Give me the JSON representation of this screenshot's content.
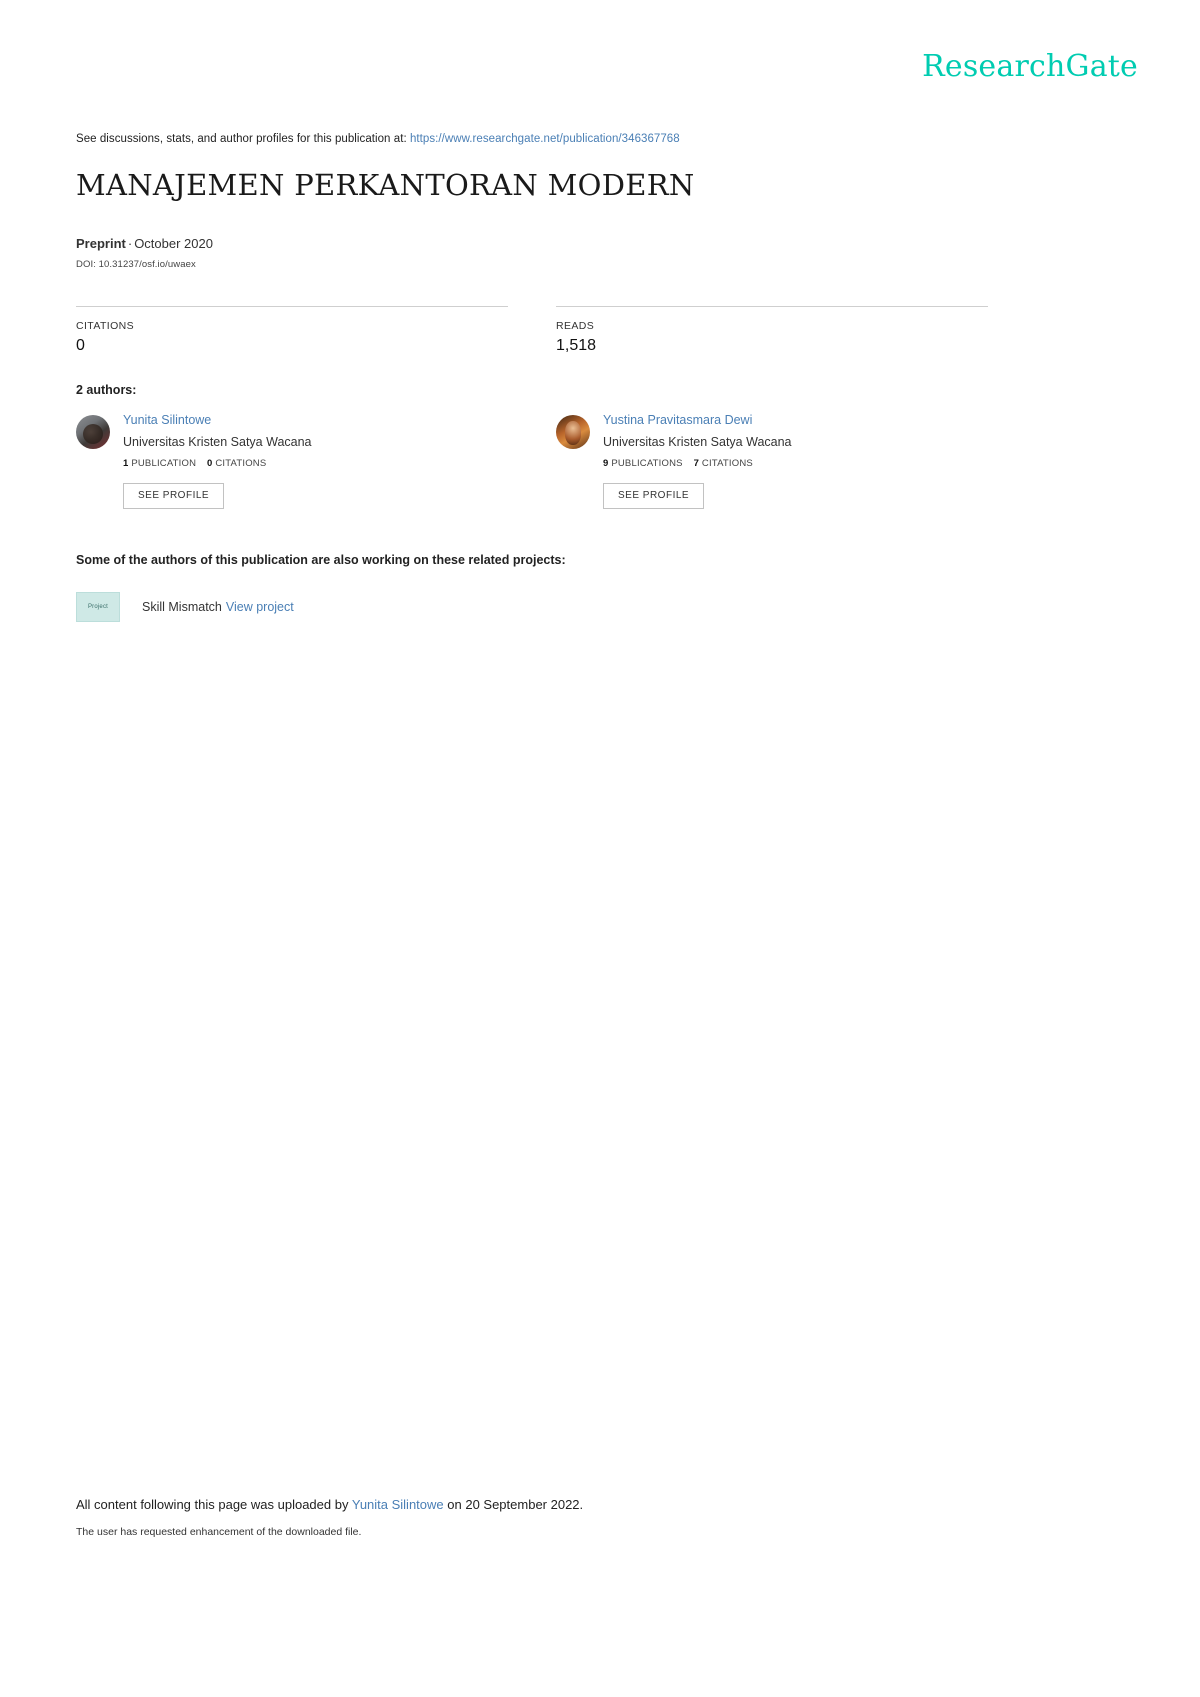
{
  "brand": {
    "logo_text": "ResearchGate",
    "logo_color": "#00ccb1",
    "link_color": "#4a7fb5"
  },
  "header": {
    "discussions_prefix": "See discussions, stats, and author profiles for this publication at:",
    "publication_url": "https://www.researchgate.net/publication/346367768"
  },
  "publication": {
    "title": "MANAJEMEN PERKANTORAN MODERN",
    "type": "Preprint",
    "separator": "·",
    "date": "October 2020",
    "doi": "DOI: 10.31237/osf.io/uwaex"
  },
  "stats": [
    {
      "label": "CITATIONS",
      "value": "0"
    },
    {
      "label": "READS",
      "value": "1,518"
    }
  ],
  "authors_section": {
    "heading": "2 authors:",
    "see_profile_label": "SEE PROFILE",
    "authors": [
      {
        "name": "Yunita Silintowe",
        "affiliation": "Universitas Kristen Satya Wacana",
        "publications_count": "1",
        "publications_label": "PUBLICATION",
        "citations_count": "0",
        "citations_label": "CITATIONS"
      },
      {
        "name": "Yustina Pravitasmara Dewi",
        "affiliation": "Universitas Kristen Satya Wacana",
        "publications_count": "9",
        "publications_label": "PUBLICATIONS",
        "citations_count": "7",
        "citations_label": "CITATIONS"
      }
    ]
  },
  "projects_section": {
    "heading": "Some of the authors of this publication are also working on these related projects:",
    "thumb_label": "Project",
    "project_name": "Skill Mismatch",
    "view_link": "View project"
  },
  "footer": {
    "upload_prefix": "All content following this page was uploaded by",
    "uploader": "Yunita Silintowe",
    "upload_suffix": "on 20 September 2022.",
    "note": "The user has requested enhancement of the downloaded file."
  }
}
